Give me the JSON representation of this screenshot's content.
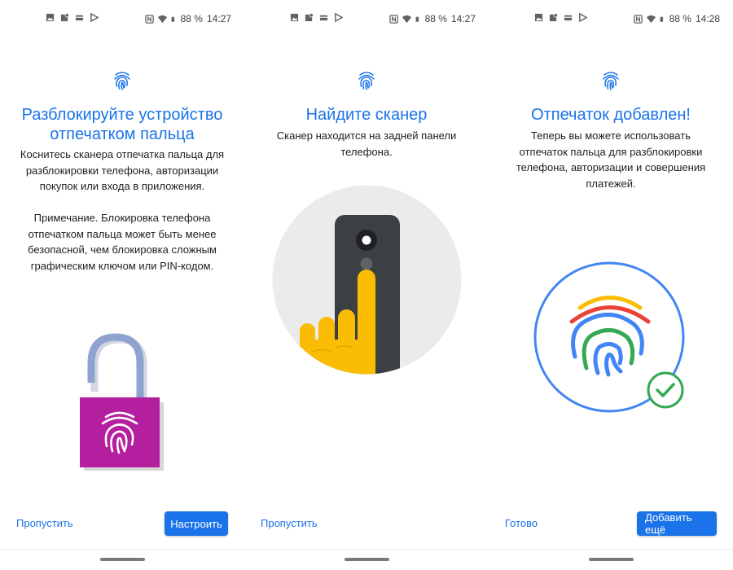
{
  "screens": [
    {
      "status": {
        "battery": "88 %",
        "time": "14:27"
      },
      "title": "Разблокируйте устройство отпечатком пальца",
      "body": "Коснитесь сканера отпечатка пальца для разблокировки телефона, авторизации покупок или входа в приложения.\n\nПримечание. Блокировка телефона отпечатком пальца может быть менее безопасной, чем блокировка сложным графическим ключом или PIN-кодом.",
      "left_button": "Пропустить",
      "right_button": "Настроить"
    },
    {
      "status": {
        "battery": "88 %",
        "time": "14:27"
      },
      "title": "Найдите сканер",
      "body": "Сканер находится на задней панели телефона.",
      "left_button": "Пропустить"
    },
    {
      "status": {
        "battery": "88 %",
        "time": "14:28"
      },
      "title": "Отпечаток добавлен!",
      "body": "Теперь вы можете использовать отпечаток пальца для разблокировки телефона, авторизации и совершения платежей.",
      "left_button": "Готово",
      "right_button": "Добавить ещё"
    }
  ],
  "icons": {
    "status_left": [
      "image-icon",
      "photo-location-icon",
      "card-icon",
      "play-store-icon"
    ],
    "status_right": [
      "nfc-icon",
      "wifi-icon",
      "battery-icon"
    ]
  },
  "colors": {
    "accent": "#1a73e8",
    "lock_body": "#b41fa0",
    "shackle": "#8fa3cf",
    "finger": "#fbbc04",
    "phone": "#3c4043",
    "google_blue": "#4285f4",
    "google_red": "#ea4335",
    "google_yellow": "#fbbc04",
    "google_green": "#34a853"
  }
}
